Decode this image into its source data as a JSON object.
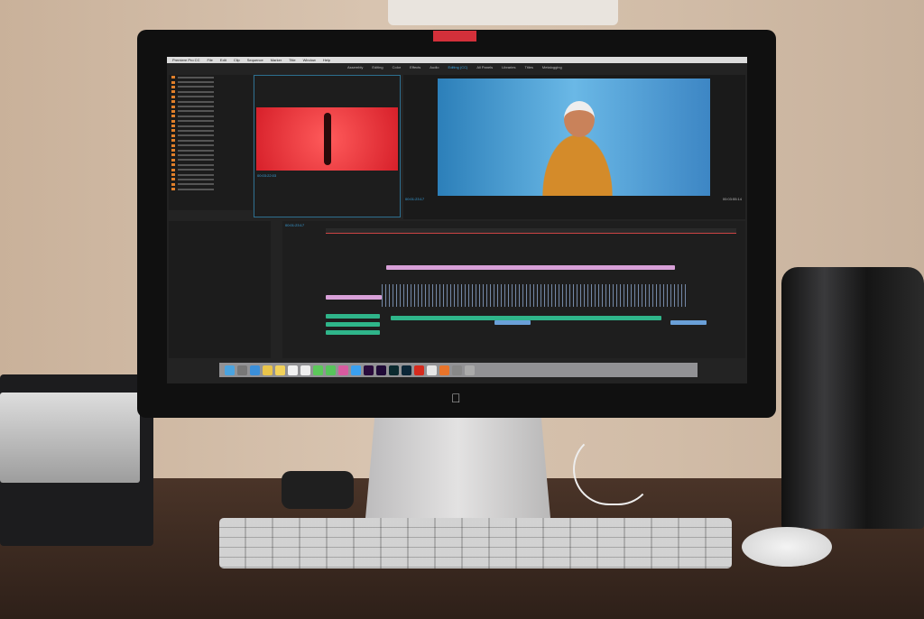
{
  "app": {
    "menu": [
      "Premiere Pro CC",
      "File",
      "Edit",
      "Clip",
      "Sequence",
      "Marker",
      "Title",
      "Window",
      "Help"
    ],
    "workspaces": [
      "Assembly",
      "Editing",
      "Color",
      "Effects",
      "Audio",
      "Editing (CC)",
      "All Panels",
      "Libraries",
      "Titles",
      "Metalogging"
    ],
    "active_workspace_index": 5,
    "source_timecode": "00:03:22:03",
    "program_timecode": "00:01:23:17",
    "program_duration": "00:03:55:14",
    "sequence_timecode": "00:01:23:17"
  },
  "colors": {
    "accent": "#3aa4e0",
    "source_frame": "#d7202a",
    "clip_pink": "#d8a0d8",
    "clip_green": "#2fb58a",
    "clip_blue": "#6aa0d8"
  },
  "dock_icons": [
    "finder",
    "launchpad",
    "safari",
    "photos",
    "notes",
    "calendar",
    "reminders",
    "messages",
    "facetime",
    "itunes",
    "app-store",
    "pr",
    "ae",
    "sg",
    "lr",
    "creative-cloud",
    "chrome",
    "firefox",
    "preferences",
    "trash"
  ]
}
